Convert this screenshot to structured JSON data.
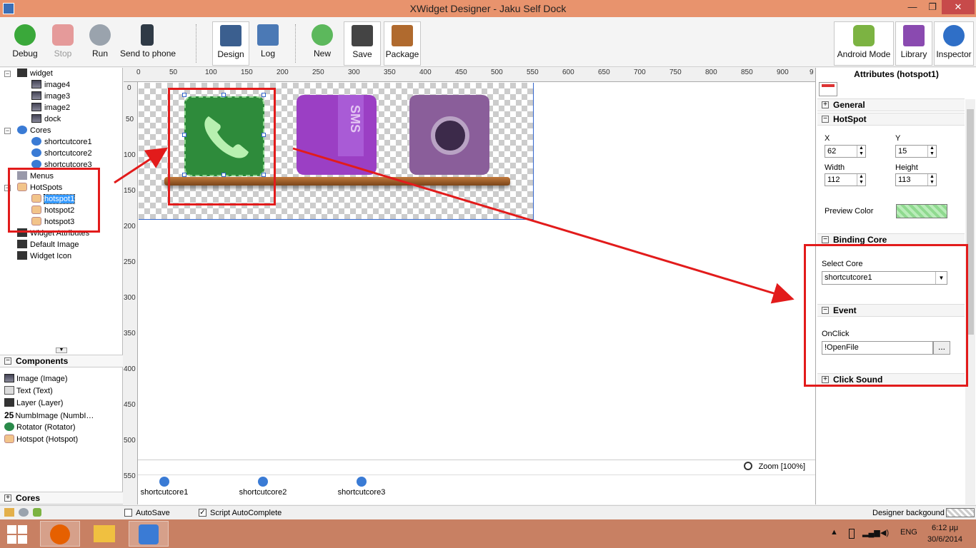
{
  "window": {
    "title": "XWidget Designer - Jaku Self Dock",
    "min": "—",
    "max": "❐",
    "close": "✕"
  },
  "toolbar": {
    "debug": "Debug",
    "stop": "Stop",
    "run": "Run",
    "send": "Send to phone",
    "design": "Design",
    "log": "Log",
    "new": "New",
    "save": "Save",
    "package": "Package",
    "android_mode": "Android Mode",
    "library": "Library",
    "inspector": "Inspector"
  },
  "tree": {
    "widget": "widget",
    "images": [
      "image4",
      "image3",
      "image2",
      "dock"
    ],
    "cores_label": "Cores",
    "cores": [
      "shortcutcore1",
      "shortcutcore2",
      "shortcutcore3"
    ],
    "menus": "Menus",
    "hotspots_label": "HotSpots",
    "hotspots": [
      "hotspot1",
      "hotspot2",
      "hotspot3"
    ],
    "widget_attributes": "Widget Attributes",
    "default_image": "Default Image",
    "widget_icon": "Widget Icon"
  },
  "components": {
    "header": "Components",
    "items": [
      "Image (Image)",
      "Text (Text)",
      "Layer (Layer)",
      "NumbImage (NumbI…",
      "Rotator (Rotator)",
      "Hotspot (Hotspot)"
    ],
    "numb_prefix": "25",
    "cores_header": "Cores"
  },
  "ruler": {
    "top": [
      "0",
      "50",
      "100",
      "150",
      "200",
      "250",
      "300",
      "350",
      "400",
      "450",
      "500",
      "550",
      "600",
      "650",
      "700",
      "750",
      "800",
      "850",
      "900",
      "9"
    ],
    "left": [
      "0",
      "50",
      "100",
      "150",
      "200",
      "250",
      "300",
      "350",
      "400",
      "450",
      "500",
      "550"
    ]
  },
  "canvas": {
    "zoom": "Zoom [100%]",
    "sms_text": "SMS",
    "cores": [
      "shortcutcore1",
      "shortcutcore2",
      "shortcutcore3"
    ]
  },
  "attributes": {
    "title": "Attributes (hotspot1)",
    "general": "General",
    "hotspot": "HotSpot",
    "x_label": "X",
    "x": "62",
    "y_label": "Y",
    "y": "15",
    "width_label": "Width",
    "width": "112",
    "height_label": "Height",
    "height": "113",
    "preview_color": "Preview Color",
    "binding_core": "Binding Core",
    "select_core_label": "Select Core",
    "select_core": "shortcutcore1",
    "event": "Event",
    "onclick_label": "OnClick",
    "onclick": "!OpenFile",
    "dots": "...",
    "click_sound": "Click Sound"
  },
  "statusbar": {
    "autosave": "AutoSave",
    "script_autocomplete": "Script AutoComplete",
    "designer_background": "Designer backgound"
  },
  "taskbar": {
    "lang": "ENG",
    "time": "6:12 μμ",
    "date": "30/6/2014"
  },
  "colors": {
    "titlebar": "#e8936d",
    "taskbar": "#c88063",
    "annotation": "#e21b1b",
    "selection": "#3399ff"
  }
}
